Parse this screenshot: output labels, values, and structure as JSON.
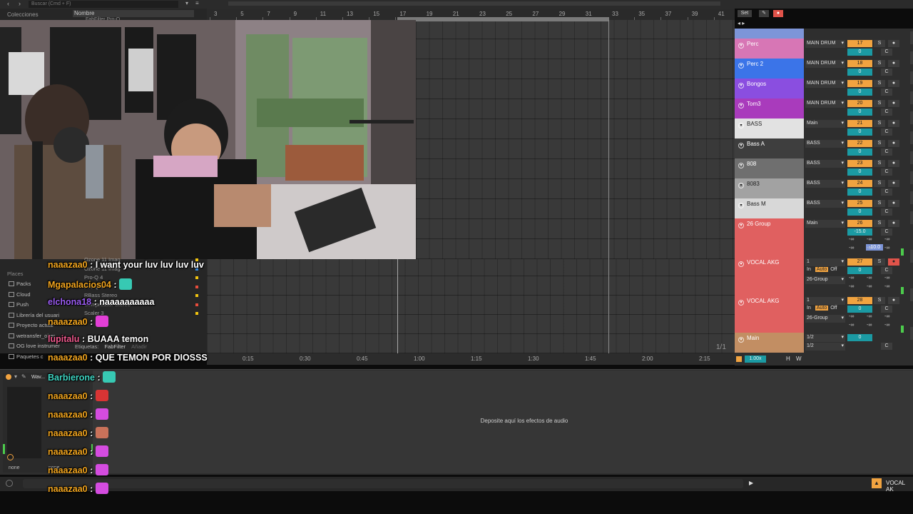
{
  "browser": {
    "search_placeholder": "Buscar (Cmd + F)",
    "collections_label": "Colecciones",
    "name_header": "Nombre",
    "file_row": "FabFilter Pro-Q",
    "places_label": "Places",
    "places": [
      "Packs",
      "Cloud",
      "Push",
      "Librería del usuari",
      "Proyecto actual",
      "wetransfer_ober",
      "OG love instrumer",
      "Paquetes c"
    ],
    "items": [
      "Ozone 11 Imag",
      "Ozone 11 Imag",
      "Pro-Q 4",
      "Pro-Q 4",
      "RBass Stereo",
      "Compressor Stereo",
      "Scaler 3"
    ],
    "tags_label": "Etiquetas:",
    "tag_value": "FabFilter",
    "add_label": "Añadir"
  },
  "ruler": {
    "bars": [
      "3",
      "5",
      "7",
      "9",
      "11",
      "13",
      "15",
      "17",
      "19",
      "21",
      "23",
      "25",
      "27",
      "29",
      "31",
      "33",
      "35",
      "37",
      "39",
      "41"
    ]
  },
  "set_button": "Set",
  "timeline": {
    "marks": [
      "0:15",
      "0:30",
      "0:45",
      "1:00",
      "1:15",
      "1:30",
      "1:45",
      "2:00",
      "2:15"
    ],
    "page": "1/1"
  },
  "mixer": {
    "tracks": [
      {
        "name": "Perc",
        "color": "#d776b5",
        "route": "MAIN DRUM",
        "num": "17",
        "vol": "0"
      },
      {
        "name": "Perc 2",
        "color": "#3b74e8",
        "route": "MAIN DRUM",
        "num": "18",
        "vol": "0"
      },
      {
        "name": "Bongos",
        "color": "#8a4ee0",
        "route": "MAIN DRUM",
        "num": "19",
        "vol": "0"
      },
      {
        "name": "Tom3",
        "color": "#a93bbc",
        "route": "MAIN DRUM",
        "num": "20",
        "vol": "0"
      },
      {
        "name": "BASS",
        "color": "#e2e2e2",
        "route": "Main",
        "num": "21",
        "vol": "0"
      },
      {
        "name": "Bass A",
        "color": "#3e3e3e",
        "route": "BASS",
        "num": "22",
        "vol": "0"
      },
      {
        "name": "808",
        "color": "#6f6f6f",
        "route": "BASS",
        "num": "23",
        "vol": "0"
      },
      {
        "name": "8083",
        "color": "#a2a2a2",
        "route": "BASS",
        "num": "24",
        "vol": "0"
      },
      {
        "name": "Bass M",
        "color": "#d8d8d8",
        "route": "BASS",
        "num": "25",
        "vol": "0"
      },
      {
        "name": "26 Group",
        "color": "#e06060",
        "route": "Main",
        "num": "26",
        "vol": "-15.0",
        "vol2": "-10.0"
      },
      {
        "name": "VOCAL AKG",
        "color": "#e06060",
        "route": "1",
        "in_label": "In",
        "auto_label": "Auto",
        "off_label": "Off",
        "route2": "26-Group",
        "num": "27",
        "vol": "0"
      },
      {
        "name": "VOCAL AKG",
        "color": "#e06060",
        "route": "1",
        "in_label": "In",
        "auto_label": "Auto",
        "off_label": "Off",
        "route2": "26-Group",
        "num": "28",
        "vol": "0"
      },
      {
        "name": "Main",
        "color": "#c28e63",
        "route": "1/2",
        "route2": "1/2",
        "vol": "0"
      }
    ],
    "solo_label": "S",
    "c_label": "C",
    "inf_label": "-∞",
    "zoom_value": "1.00x",
    "h_label": "H",
    "w_label": "W"
  },
  "device": {
    "drop_text": "Deposite aquí los efectos de audio",
    "track_short": "Wav...",
    "none_label": "none",
    "none_label2": "none"
  },
  "status": {
    "track_name": "VOCAL AK"
  },
  "chat": [
    {
      "user": "naaazaa0",
      "color": "#f2a51e",
      "text": "I want your luv luv luv luv"
    },
    {
      "user": "Mgapalacios04",
      "color": "#f2a51e",
      "text": "",
      "emote": "#37c9b3"
    },
    {
      "user": "elchona18",
      "color": "#9b5cf2",
      "text": "naaaaaaaaaa"
    },
    {
      "user": "naaazaa0",
      "color": "#f2a51e",
      "text": "",
      "emote": "#e23fd6"
    },
    {
      "user": "lupitalu",
      "color": "#f05a8e",
      "text": "BUAAA temon"
    },
    {
      "user": "naaazaa0",
      "color": "#f2a51e",
      "text": "QUE TEMON POR DIOSSS"
    },
    {
      "user": "Barbierone",
      "color": "#3fd6c3",
      "text": "",
      "emote": "#37c9b3"
    },
    {
      "user": "naaazaa0",
      "color": "#f2a51e",
      "text": "",
      "emote": "#d83434"
    },
    {
      "user": "naaazaa0",
      "color": "#f2a51e",
      "text": "",
      "emote": "#d44ce0"
    },
    {
      "user": "naaazaa0",
      "color": "#f2a51e",
      "text": "",
      "emote": "#c9725a"
    },
    {
      "user": "naaazaa0",
      "color": "#f2a51e",
      "text": "",
      "emote": "#d44ce0"
    },
    {
      "user": "naaazaa0",
      "color": "#f2a51e",
      "text": "",
      "emote": "#d44ce0"
    },
    {
      "user": "naaazaa0",
      "color": "#f2a51e",
      "text": "",
      "emote": "#d44ce0"
    }
  ]
}
